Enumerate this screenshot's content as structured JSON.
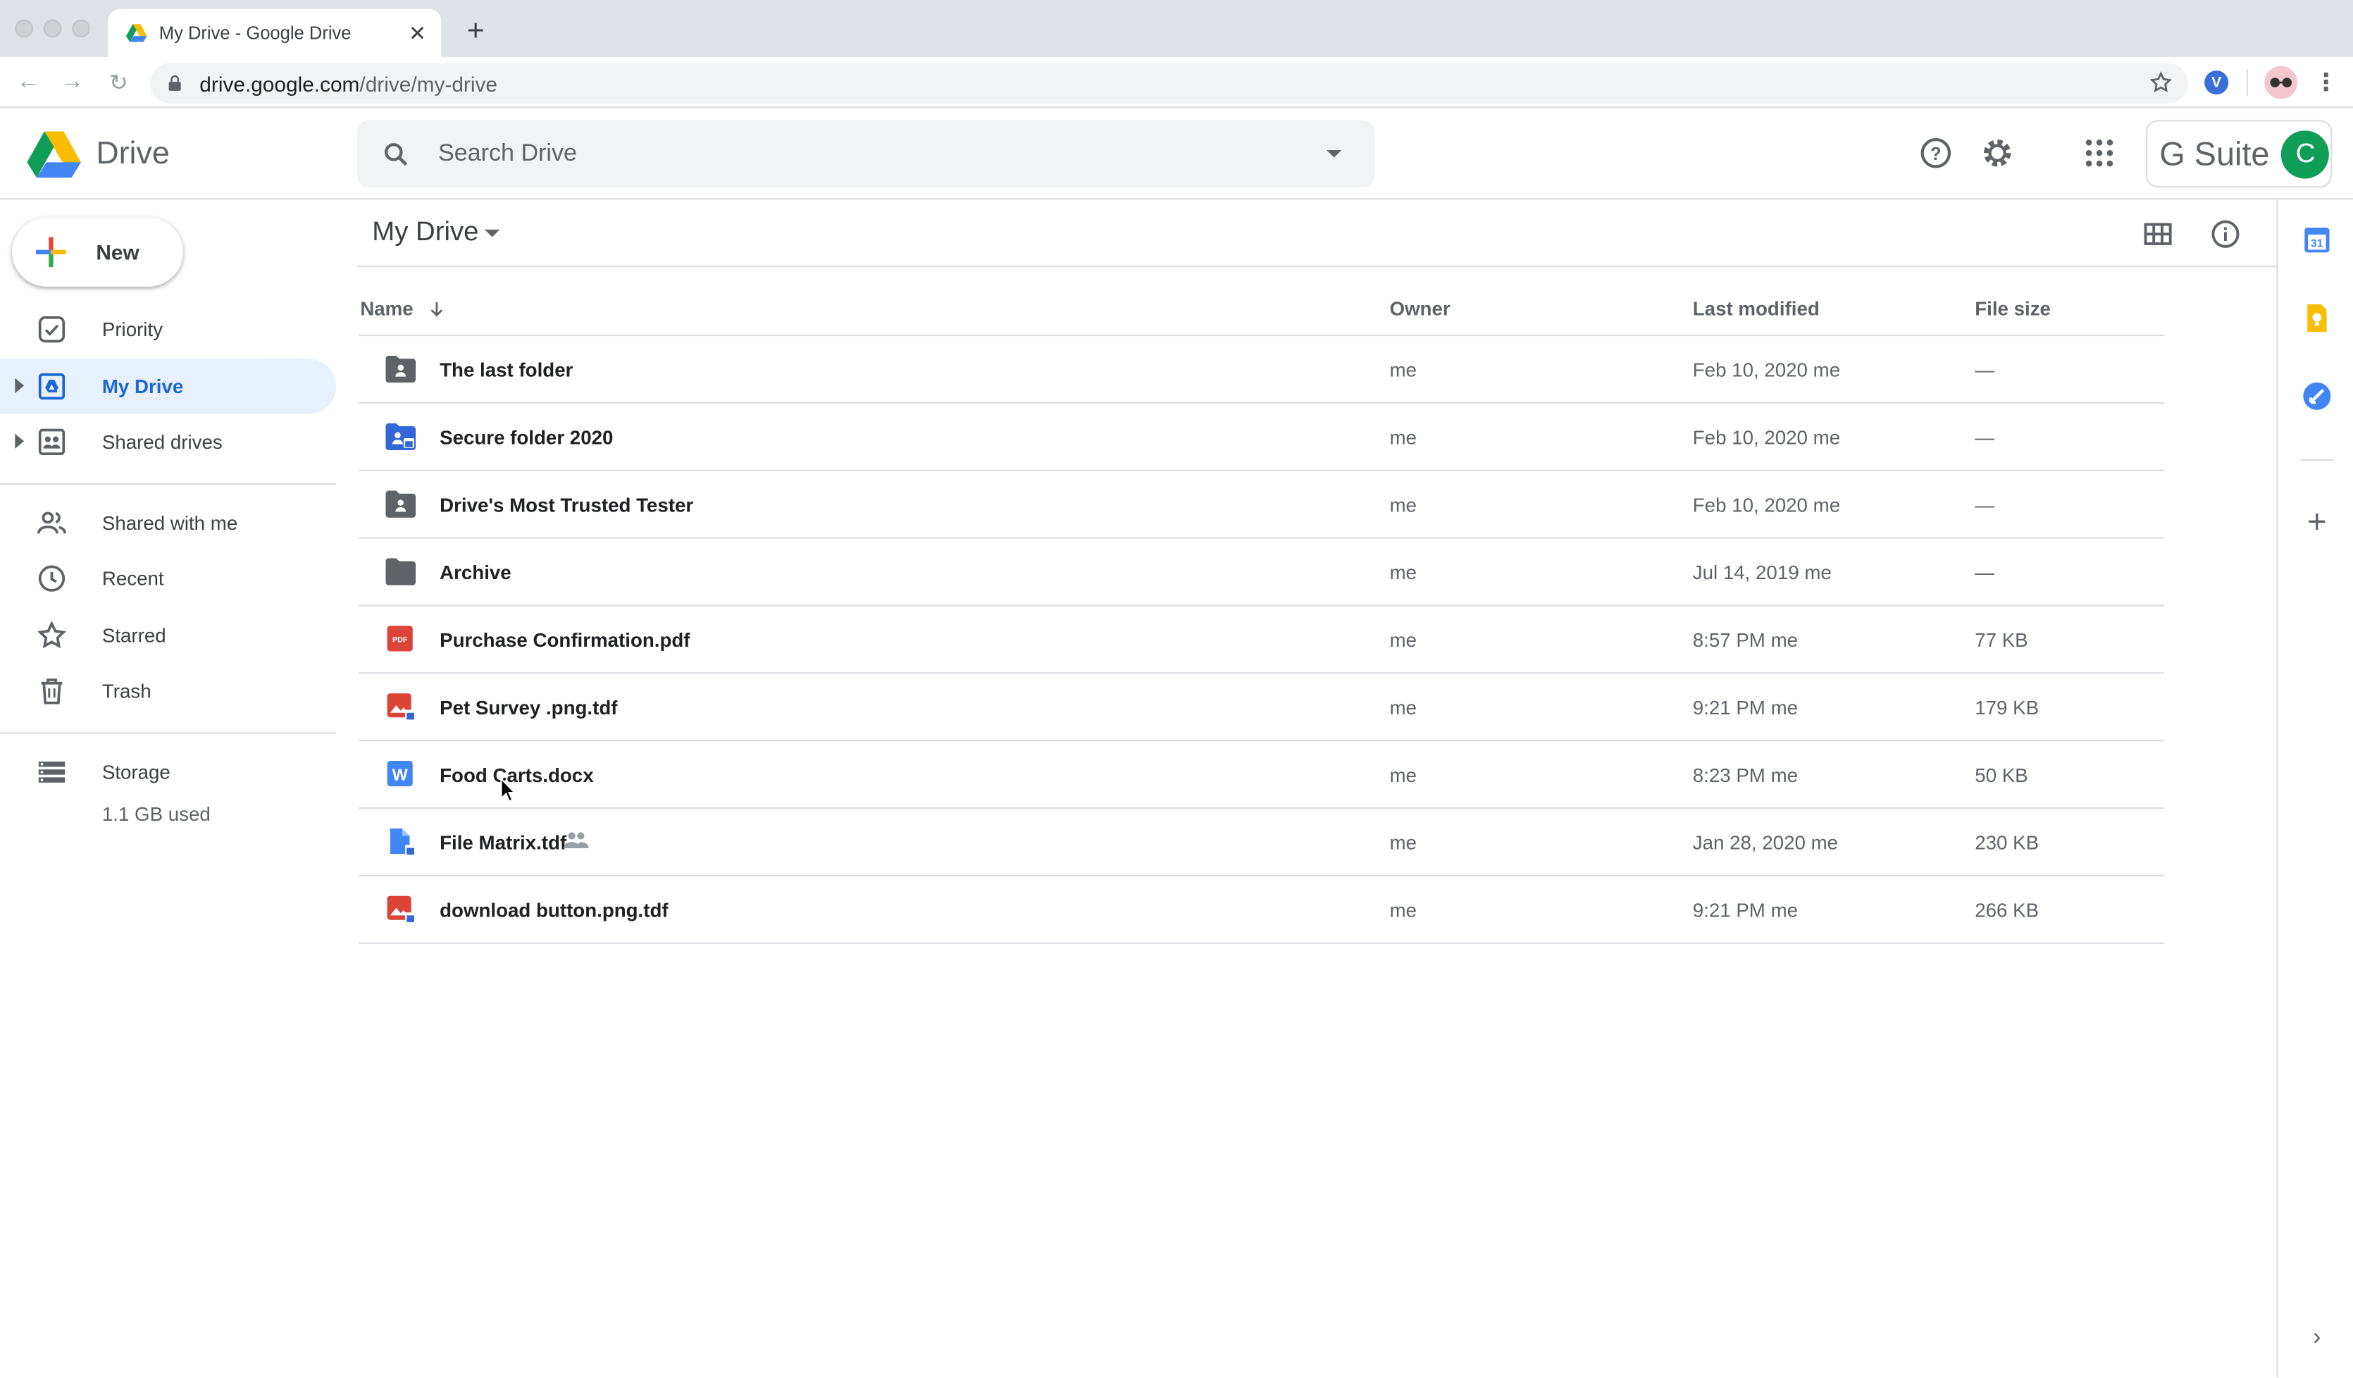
{
  "browser": {
    "tab_title": "My Drive - Google Drive",
    "url_host": "drive.google.com",
    "url_path": "/drive/my-drive"
  },
  "header": {
    "app_name": "Drive",
    "search_placeholder": "Search Drive",
    "gsuite_label": "G Suite",
    "avatar_letter": "C"
  },
  "sidebar": {
    "new_label": "New",
    "items": [
      {
        "label": "Priority",
        "icon": "priority-icon"
      },
      {
        "label": "My Drive",
        "icon": "my-drive-icon",
        "active": true
      },
      {
        "label": "Shared drives",
        "icon": "shared-drives-icon"
      },
      {
        "label": "Shared with me",
        "icon": "shared-with-me-icon"
      },
      {
        "label": "Recent",
        "icon": "clock-icon"
      },
      {
        "label": "Starred",
        "icon": "star-icon"
      },
      {
        "label": "Trash",
        "icon": "trash-icon"
      },
      {
        "label": "Storage",
        "icon": "storage-icon"
      }
    ],
    "storage_used": "1.1 GB used"
  },
  "main": {
    "title": "My Drive",
    "columns": {
      "name": "Name",
      "owner": "Owner",
      "last_modified": "Last modified",
      "file_size": "File size"
    },
    "files": [
      {
        "name": "The last folder",
        "owner": "me",
        "modified": "Feb 10, 2020  me",
        "size": "—",
        "type": "shared-folder"
      },
      {
        "name": "Secure folder 2020",
        "owner": "me",
        "modified": "Feb 10, 2020  me",
        "size": "—",
        "type": "secure-folder"
      },
      {
        "name": "Drive's Most Trusted Tester",
        "owner": "me",
        "modified": "Feb 10, 2020  me",
        "size": "—",
        "type": "shared-folder"
      },
      {
        "name": "Archive",
        "owner": "me",
        "modified": "Jul 14, 2019  me",
        "size": "—",
        "type": "folder"
      },
      {
        "name": "Purchase Confirmation.pdf",
        "owner": "me",
        "modified": "8:57 PM  me",
        "size": "77 KB",
        "type": "pdf"
      },
      {
        "name": "Pet Survey .png.tdf",
        "owner": "me",
        "modified": "9:21 PM  me",
        "size": "179 KB",
        "type": "secure-image"
      },
      {
        "name": "Food Carts.docx",
        "owner": "me",
        "modified": "8:23 PM  me",
        "size": "50 KB",
        "type": "word"
      },
      {
        "name": "File Matrix.tdf",
        "owner": "me",
        "modified": "Jan 28, 2020  me",
        "size": "230 KB",
        "type": "secure-doc",
        "shared": true
      },
      {
        "name": "download button.png.tdf",
        "owner": "me",
        "modified": "9:21 PM  me",
        "size": "266 KB",
        "type": "secure-image"
      }
    ]
  },
  "colors": {
    "accent": "#1967d2",
    "active_bg": "#e8f0fe",
    "folder_grey": "#5f6368",
    "pdf_red": "#db4437",
    "word_blue": "#4285f4",
    "secure_blue": "#3367d6"
  }
}
